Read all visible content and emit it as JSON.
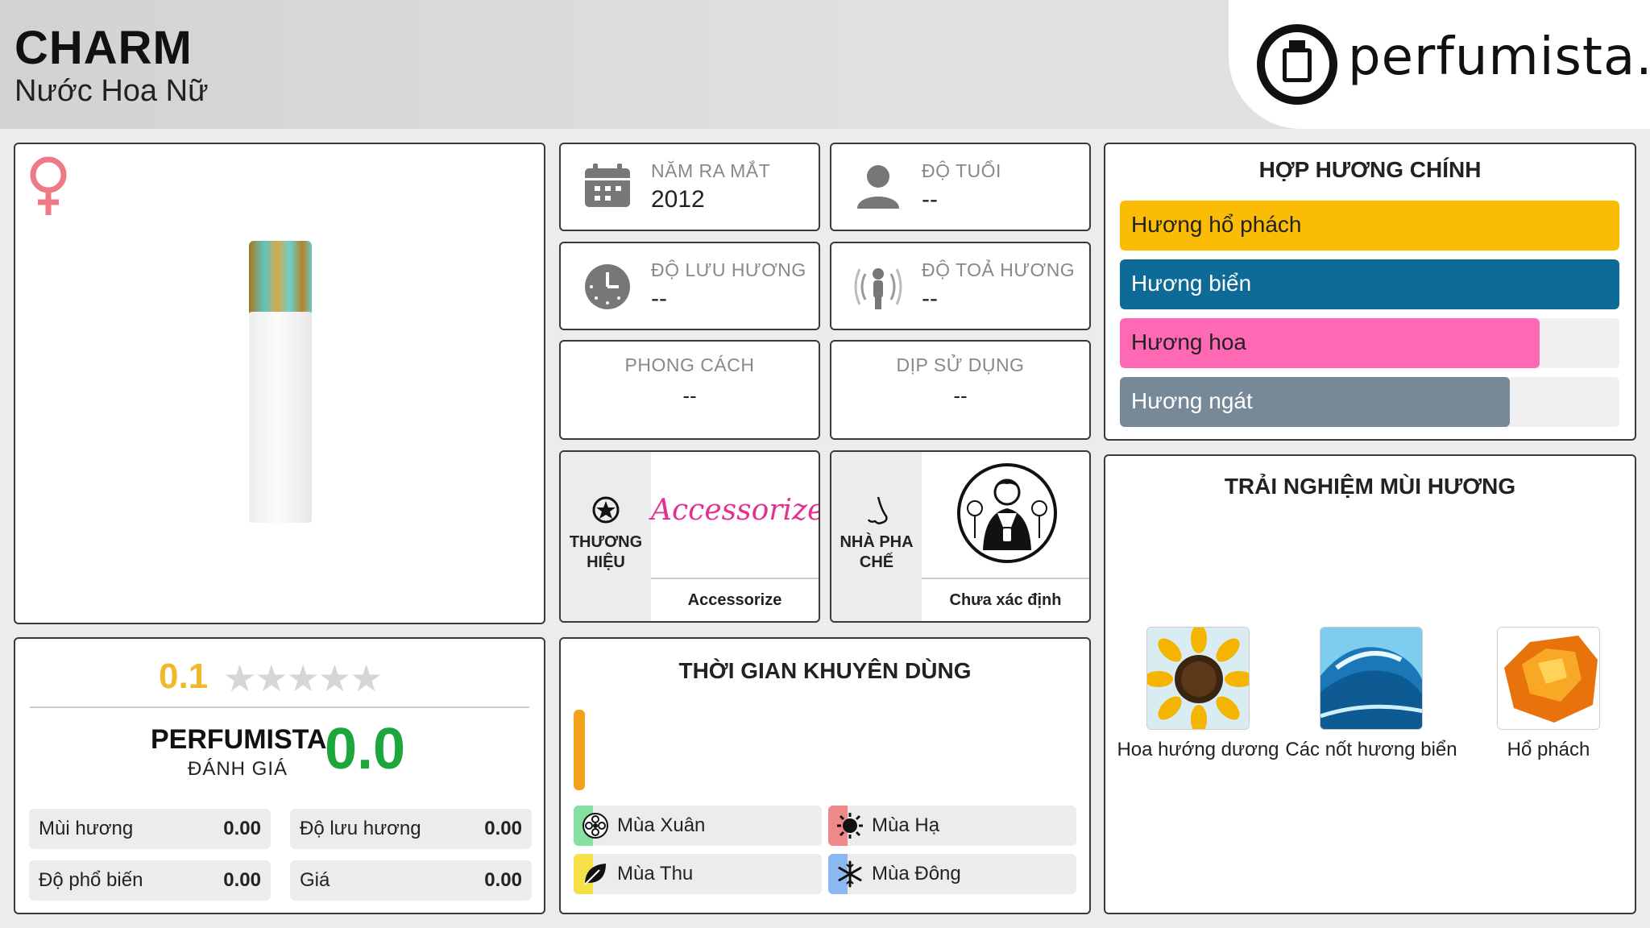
{
  "header": {
    "title": "CHARM",
    "subtitle": "Nước Hoa Nữ",
    "logo_text": "perfumista.vn"
  },
  "info": {
    "release_label": "NĂM RA MẮT",
    "release_value": "2012",
    "age_label": "ĐỘ TUỔI",
    "age_value": "--",
    "longevity_label": "ĐỘ LƯU HƯƠNG",
    "longevity_value": "--",
    "sillage_label": "ĐỘ TOẢ HƯƠNG",
    "sillage_value": "--",
    "style_label": "PHONG CÁCH",
    "style_value": "--",
    "occasion_label": "DỊP SỬ DỤNG",
    "occasion_value": "--",
    "brand_label": "THƯƠNG HIỆU",
    "brand_logo_text": "Accessorize",
    "brand_name": "Accessorize",
    "perfumer_label": "NHÀ PHA CHẾ",
    "perfumer_name": "Chưa xác định"
  },
  "notes": {
    "title": "HỢP HƯƠNG CHÍNH",
    "items": [
      {
        "label": "Hương hổ phách",
        "fill": 1.0,
        "color": "#fbbc05"
      },
      {
        "label": "Hương biển",
        "fill": 1.0,
        "color": "#0e6a96"
      },
      {
        "label": "Hương hoa",
        "fill": 0.84,
        "color": "#ff69b4"
      },
      {
        "label": "Hương ngát",
        "fill": 0.78,
        "color": "#778899"
      }
    ]
  },
  "experience": {
    "title": "TRẢI NGHIỆM MÙI HƯƠNG",
    "items": [
      {
        "name": "Hoa hướng dương"
      },
      {
        "name": "Các nốt hương biển"
      },
      {
        "name": "Hổ phách"
      }
    ]
  },
  "rating": {
    "score": "0.1",
    "stars_filled": 0,
    "stars_total": 5,
    "stars_text": "★★★★★",
    "pf_name": "PERFUMISTA",
    "pf_sub": "ĐÁNH GIÁ",
    "pf_score": "0.0",
    "metrics": [
      {
        "label": "Mùi hương",
        "value": "0.00"
      },
      {
        "label": "Độ lưu hương",
        "value": "0.00"
      },
      {
        "label": "Độ phổ biến",
        "value": "0.00"
      },
      {
        "label": "Giá",
        "value": "0.00"
      }
    ]
  },
  "time": {
    "title": "THỜI GIAN KHUYÊN DÙNG",
    "seasons": [
      {
        "label": "Mùa Xuân",
        "color": "#86e0a0"
      },
      {
        "label": "Mùa Hạ",
        "color": "#f08a8a"
      },
      {
        "label": "Mùa Thu",
        "color": "#f5e04a"
      },
      {
        "label": "Mùa Đông",
        "color": "#8ab8f0"
      }
    ]
  }
}
